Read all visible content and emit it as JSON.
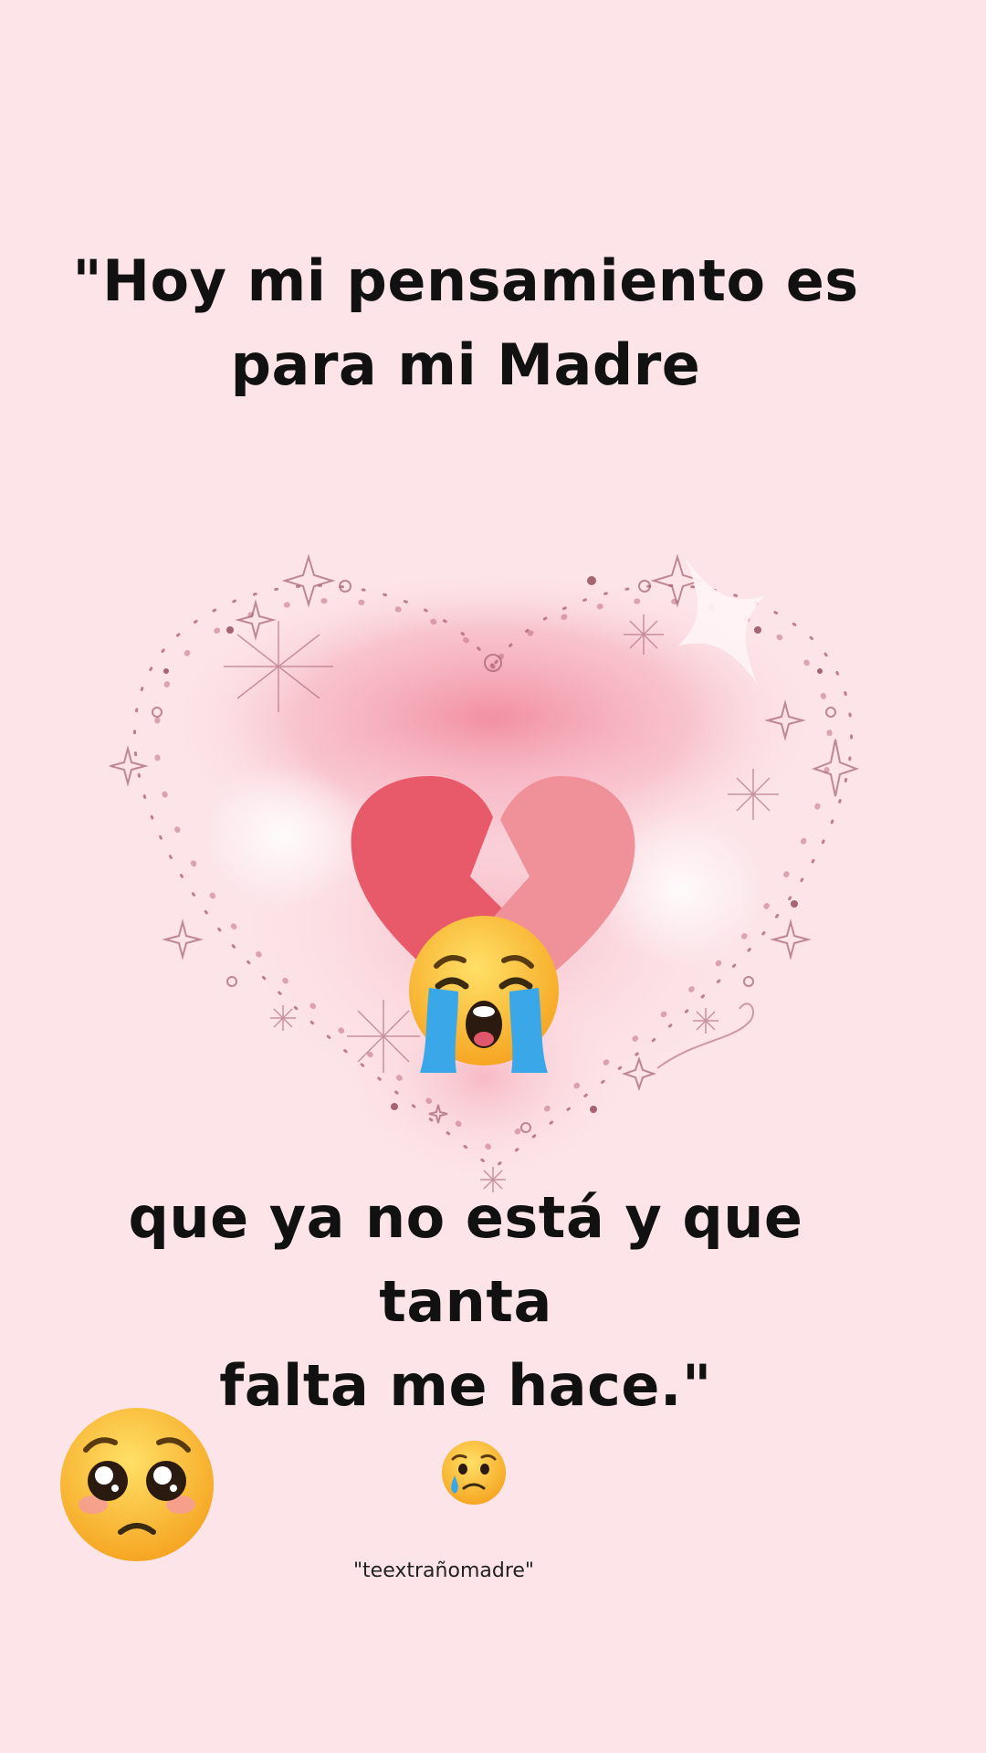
{
  "quote": {
    "top_line_1": "\"Hoy mi pensamiento es",
    "top_line_2": "para mi Madre",
    "bottom_line_1": "que  ya no está y que",
    "bottom_line_2": "tanta",
    "bottom_line_3": "falta me hace.\""
  },
  "footer": {
    "handle": "\"teextrañomadre\""
  },
  "icons": {
    "center": "broken-heart-icon",
    "crying": "loudly-crying-face-icon",
    "pleading": "pleading-face-icon",
    "tear": "crying-face-icon"
  },
  "colors": {
    "background": "#fce4e8",
    "heart_glow": "#f08aa0",
    "broken_heart_left": "#e85a6a",
    "broken_heart_right": "#f09098",
    "emoji_yellow": "#fbc531",
    "tear_blue": "#3aa7e8"
  }
}
